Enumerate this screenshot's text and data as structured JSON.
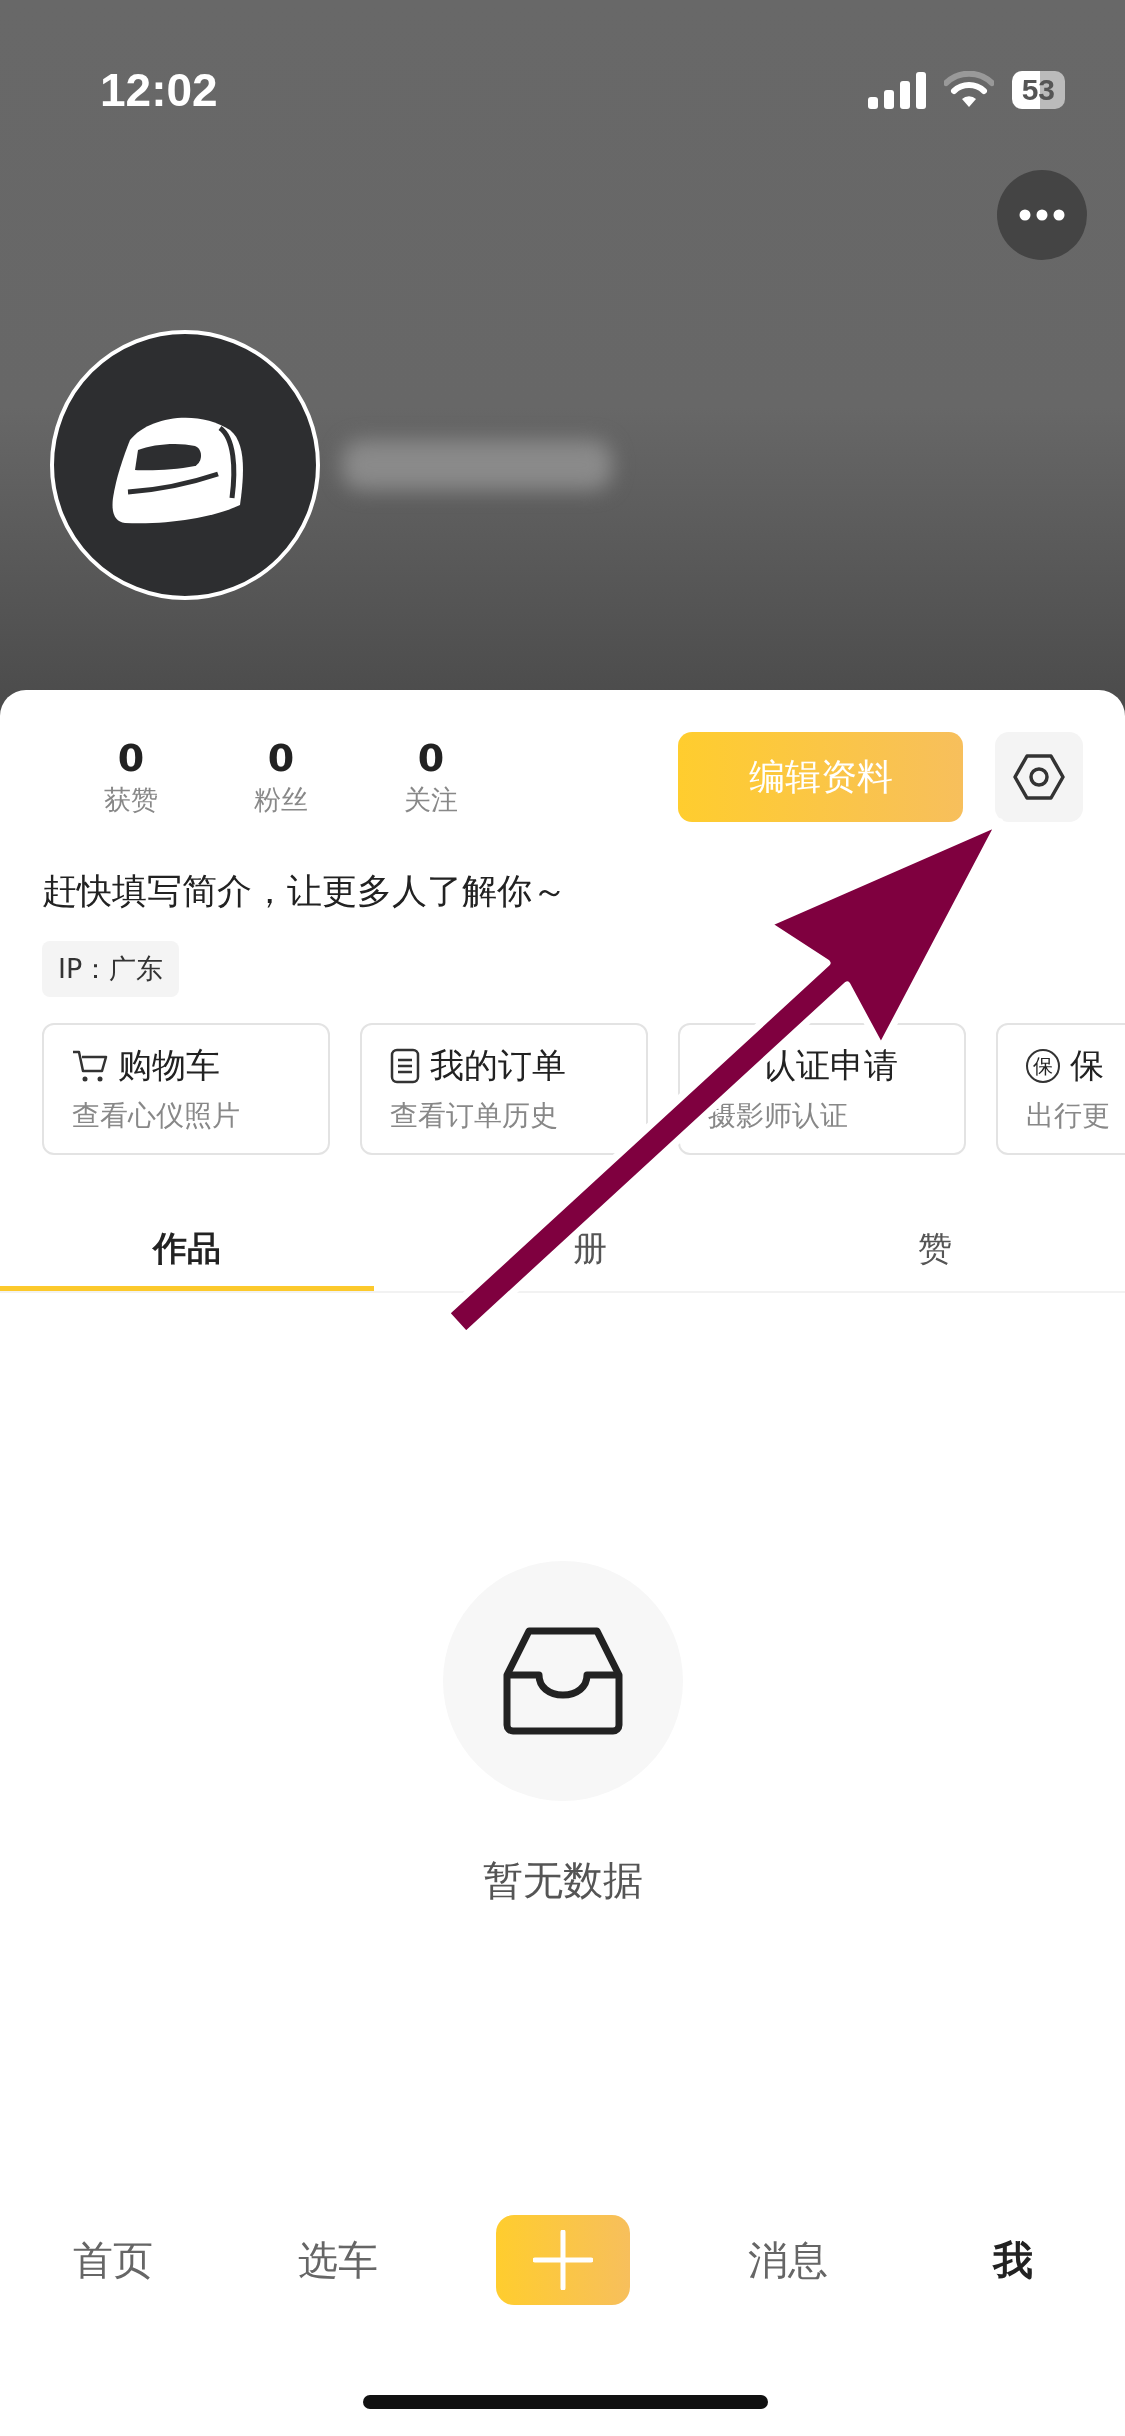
{
  "status_bar": {
    "time": "12:02",
    "battery": "53"
  },
  "profile": {
    "stats": [
      {
        "value": "0",
        "label": "获赞"
      },
      {
        "value": "0",
        "label": "粉丝"
      },
      {
        "value": "0",
        "label": "关注"
      }
    ],
    "edit_button": "编辑资料",
    "bio": "赶快填写简介，让更多人了解你～",
    "ip_tag": "IP：广东"
  },
  "cards": [
    {
      "kind": "cart",
      "title": "购物车",
      "subtitle": "查看心仪照片"
    },
    {
      "kind": "orders",
      "title": "我的订单",
      "subtitle": "查看订单历史"
    },
    {
      "kind": "covered",
      "title": "认证申请",
      "subtitle": "摄影师认证"
    },
    {
      "kind": "seal",
      "icon_text": "保",
      "title": "保",
      "subtitle": "出行更"
    }
  ],
  "tabs": [
    {
      "label": "作品",
      "selected": true
    },
    {
      "label": "册",
      "selected": false,
      "kind": "partly_covered"
    },
    {
      "label": "赞",
      "selected": false
    }
  ],
  "empty_state": {
    "text": "暂无数据"
  },
  "bottom_nav": [
    {
      "kind": "text",
      "label": "首页",
      "selected": false
    },
    {
      "kind": "text",
      "label": "选车",
      "selected": false
    },
    {
      "kind": "add"
    },
    {
      "kind": "text",
      "label": "消息",
      "selected": false
    },
    {
      "kind": "text",
      "label": "我",
      "selected": true
    }
  ]
}
